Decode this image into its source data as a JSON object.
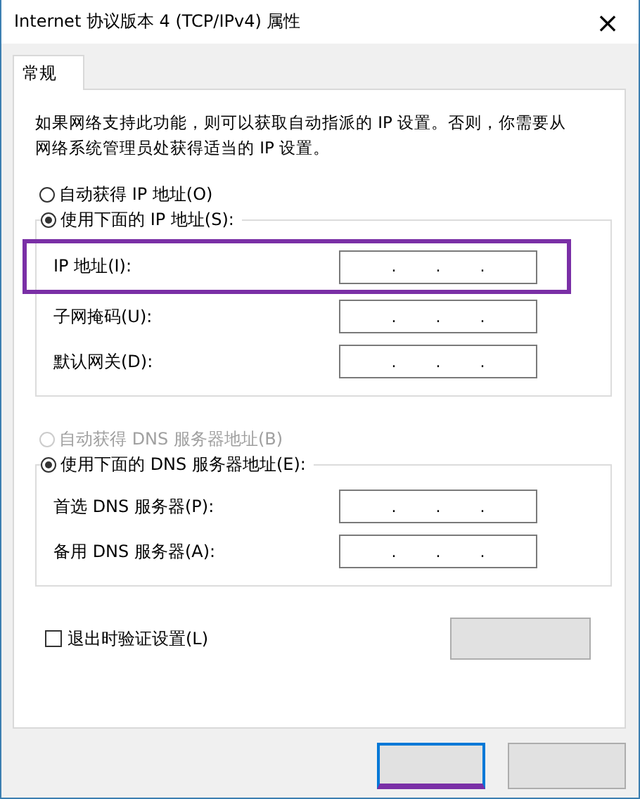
{
  "window": {
    "title": "Internet 协议版本 4 (TCP/IPv4) 属性",
    "close": "×"
  },
  "tabs": [
    {
      "label": "常规",
      "selected": true
    }
  ],
  "description": "如果网络支持此功能，则可以获取自动指派的 IP 设置。否则，你需要从网络系统管理员处获得适当的 IP 设置。",
  "ip_mode": [
    {
      "label": "自动获得 IP 地址(O)",
      "selected": false,
      "disabled": false
    },
    {
      "label": "使用下面的 IP 地址(S):",
      "selected": true,
      "disabled": false
    }
  ],
  "ip_fields": [
    {
      "label": "IP 地址(I):",
      "dots": [
        ".",
        ".",
        "."
      ],
      "highlighted": true
    },
    {
      "label": "子网掩码(U):",
      "dots": [
        ".",
        ".",
        "."
      ],
      "highlighted": false
    },
    {
      "label": "默认网关(D):",
      "dots": [
        ".",
        ".",
        "."
      ],
      "highlighted": false
    }
  ],
  "dns_mode": [
    {
      "label": "自动获得 DNS 服务器地址(B)",
      "selected": false,
      "disabled": true
    },
    {
      "label": "使用下面的 DNS 服务器地址(E):",
      "selected": true,
      "disabled": false
    }
  ],
  "dns_fields": [
    {
      "label": "首选 DNS 服务器(P):",
      "dots": [
        ".",
        ".",
        "."
      ],
      "highlighted": false
    },
    {
      "label": "备用 DNS 服务器(A):",
      "dots": [
        ".",
        ".",
        "."
      ],
      "highlighted": false
    }
  ],
  "validate": {
    "label": "退出时验证设置(L)",
    "checked": false
  },
  "buttons": [
    {
      "kind": "advanced",
      "highlighted": false
    },
    {
      "kind": "ok",
      "highlighted": true
    },
    {
      "kind": "cancel",
      "highlighted": false
    }
  ]
}
